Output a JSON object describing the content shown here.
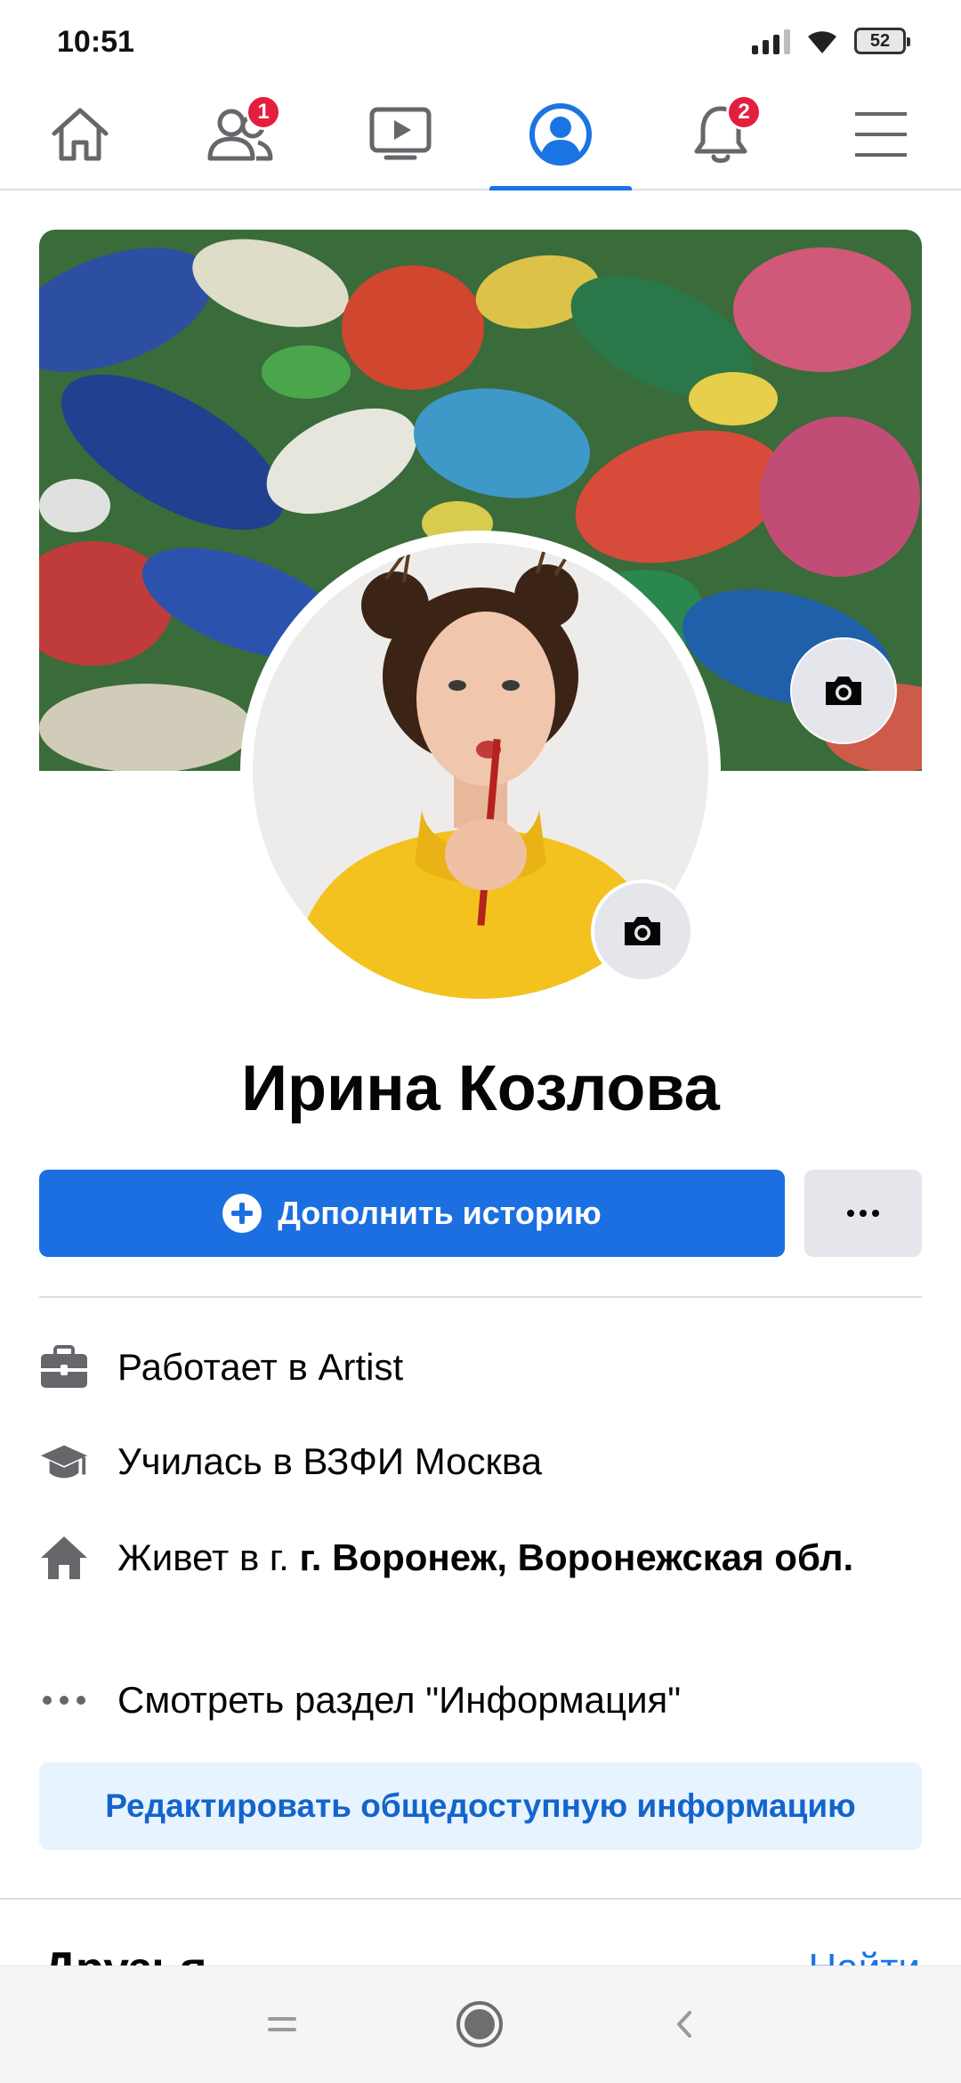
{
  "status_bar": {
    "time": "10:51",
    "battery": "52",
    "icons": [
      "signal-icon",
      "wifi-icon",
      "battery-icon"
    ]
  },
  "top_nav": {
    "items": [
      {
        "name": "home",
        "icon": "home-icon"
      },
      {
        "name": "friends",
        "icon": "friends-icon",
        "badge": "1"
      },
      {
        "name": "watch",
        "icon": "video-icon"
      },
      {
        "name": "profile",
        "icon": "profile-icon",
        "active": true
      },
      {
        "name": "notifications",
        "icon": "bell-icon",
        "badge": "2"
      },
      {
        "name": "menu",
        "icon": "hamburger-icon"
      }
    ],
    "accent_color": "#1b74e4",
    "badge_color": "#e41e3f"
  },
  "profile": {
    "name": "Ирина Козлова"
  },
  "actions": {
    "add_story_label": "Дополнить историю",
    "more_icon": "more-dots-icon"
  },
  "intro": {
    "work_prefix": "Работает в ",
    "work_place": "Artist",
    "study_prefix": "Училась в ",
    "study_place": "ВЗФИ Москва",
    "lives_prefix": "Живет в г. ",
    "lives_place": "г. Воронеж, Воронежская обл.",
    "see_about": "Смотреть раздел \"Информация\"",
    "edit_button": "Редактировать общедоступную информацию"
  },
  "friends": {
    "title": "Друзья",
    "find": "Найти"
  },
  "colors": {
    "primary_button": "#1b6fe0",
    "edit_button_bg": "#e7f3ff",
    "edit_button_text": "#1464cc"
  }
}
